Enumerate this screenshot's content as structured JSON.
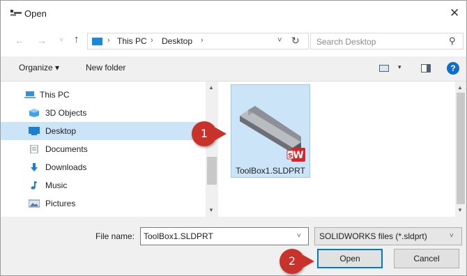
{
  "window": {
    "title": "Open",
    "close_glyph": "✕"
  },
  "nav": {
    "back_glyph": "←",
    "forward_glyph": "→",
    "recent_glyph": "˅",
    "up_glyph": "↑",
    "breadcrumb": [
      "This PC",
      "Desktop"
    ],
    "separator": "›",
    "dropdown_glyph": "˅",
    "refresh_glyph": "↻",
    "search_placeholder": "Search Desktop",
    "search_glyph": "⚲"
  },
  "toolbar": {
    "organize_label": "Organize ▾",
    "new_folder_label": "New folder",
    "view_dropdown_glyph": "▾",
    "help_glyph": "?"
  },
  "sidebar": {
    "items": [
      {
        "label": "This PC",
        "icon": "pc-icon",
        "selected": false
      },
      {
        "label": "3D Objects",
        "icon": "3d-objects-icon",
        "selected": false
      },
      {
        "label": "Desktop",
        "icon": "desktop-icon",
        "selected": true
      },
      {
        "label": "Documents",
        "icon": "documents-icon",
        "selected": false
      },
      {
        "label": "Downloads",
        "icon": "downloads-icon",
        "selected": false
      },
      {
        "label": "Music",
        "icon": "music-icon",
        "selected": false
      },
      {
        "label": "Pictures",
        "icon": "pictures-icon",
        "selected": false
      }
    ],
    "scroll_up_glyph": "▲",
    "scroll_down_glyph": "▼"
  },
  "files": {
    "items": [
      {
        "name": "ToolBox1.SLDPRT",
        "icon": "solidworks-part-icon",
        "badge": "W",
        "selected": true
      }
    ],
    "scroll_up_glyph": "▲",
    "scroll_down_glyph": "▼"
  },
  "bottom": {
    "file_name_label": "File name:",
    "file_name_value": "ToolBox1.SLDPRT",
    "file_name_dropdown_glyph": "˅",
    "file_type_value": "SOLIDWORKS files (*.sldprt)",
    "file_type_dropdown_glyph": "˅",
    "open_label": "Open",
    "cancel_label": "Cancel"
  },
  "callouts": {
    "step1": "1",
    "step2": "2"
  },
  "colors": {
    "selection": "#cce4f7",
    "accent": "#0078d7",
    "callout": "#c8322a",
    "solidworks_red": "#d6262b"
  }
}
